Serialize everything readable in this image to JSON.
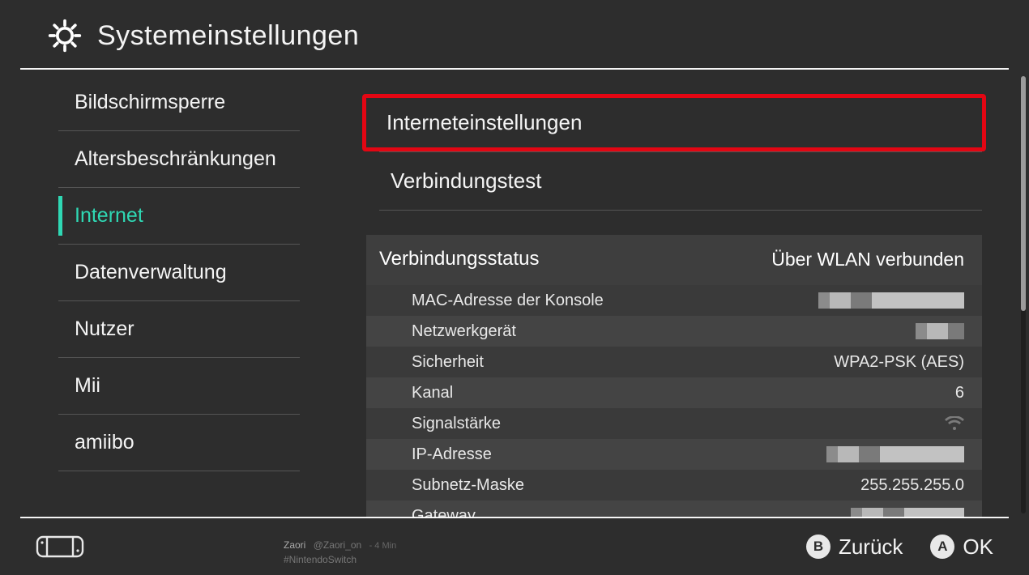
{
  "header": {
    "title": "Systemeinstellungen"
  },
  "sidebar": {
    "items": [
      {
        "label": "Bildschirmsperre",
        "active": false
      },
      {
        "label": "Altersbeschränkungen",
        "active": false
      },
      {
        "label": "Internet",
        "active": true
      },
      {
        "label": "Datenverwaltung",
        "active": false
      },
      {
        "label": "Nutzer",
        "active": false
      },
      {
        "label": "Mii",
        "active": false
      },
      {
        "label": "amiibo",
        "active": false
      }
    ]
  },
  "main": {
    "menu": [
      {
        "label": "Interneteinstellungen",
        "highlighted": true
      },
      {
        "label": "Verbindungstest",
        "highlighted": false
      }
    ],
    "status": {
      "title": "Verbindungsstatus",
      "value": "Über WLAN verbunden",
      "rows": [
        {
          "label": "MAC-Adresse der Konsole",
          "value": null,
          "redacted": "mac"
        },
        {
          "label": "Netzwerkgerät",
          "value": null,
          "redacted": "ssid"
        },
        {
          "label": "Sicherheit",
          "value": "WPA2-PSK (AES)"
        },
        {
          "label": "Kanal",
          "value": "6"
        },
        {
          "label": "Signalstärke",
          "value": null,
          "icon": "wifi"
        },
        {
          "label": "IP-Adresse",
          "value": null,
          "redacted": "ip"
        },
        {
          "label": "Subnetz-Maske",
          "value": "255.255.255.0"
        },
        {
          "label": "Gateway",
          "value": null,
          "redacted": "gw"
        }
      ]
    }
  },
  "footer": {
    "ghost": {
      "user": "Zaori",
      "handle": "@Zaori_on",
      "time": "- 4 Min",
      "tag": "#NintendoSwitch"
    },
    "hints": [
      {
        "key": "B",
        "label": "Zurück"
      },
      {
        "key": "A",
        "label": "OK"
      }
    ]
  },
  "colors": {
    "accent": "#2fd8b4",
    "highlight": "#e30613"
  }
}
